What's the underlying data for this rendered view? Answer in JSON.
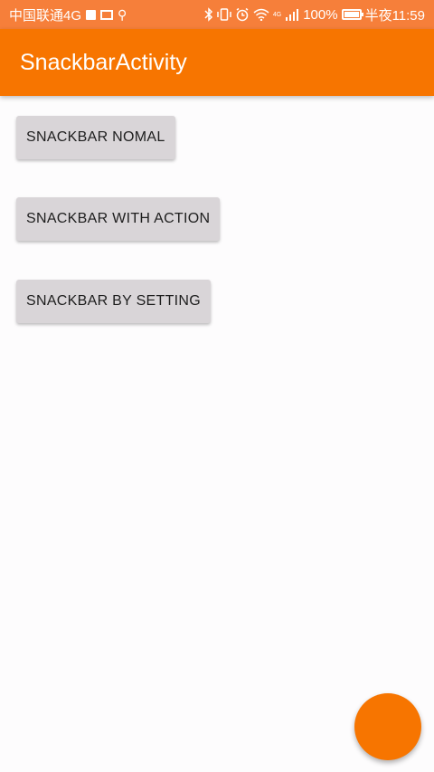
{
  "status_bar": {
    "carrier": "中国联通4G",
    "network_badge": "4G",
    "battery": "100%",
    "time": "半夜11:59",
    "icons": [
      "square-icon",
      "image-icon",
      "usb-icon",
      "bluetooth-icon",
      "vibrate-icon",
      "alarm-icon",
      "wifi-icon",
      "signal-icon",
      "battery-icon"
    ]
  },
  "app_bar": {
    "title": "SnackbarActivity"
  },
  "buttons": [
    {
      "label": "SNACKBAR NOMAL"
    },
    {
      "label": "SNACKBAR WITH ACTION"
    },
    {
      "label": "SNACKBAR BY SETTING"
    }
  ],
  "colors": {
    "status_bar": "#f67f3a",
    "app_bar": "#f77500",
    "fab": "#f77500",
    "button_bg": "#d9d5d8"
  }
}
